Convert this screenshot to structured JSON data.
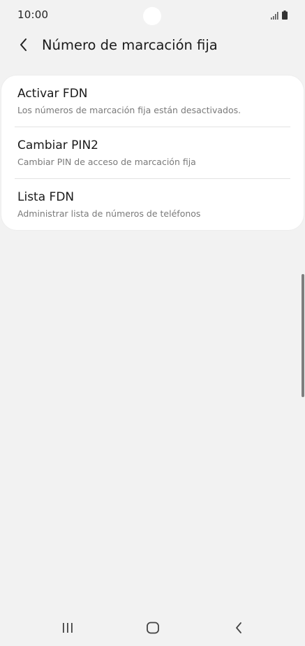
{
  "status_bar": {
    "time": "10:00",
    "icons": [
      "signal-icon",
      "battery-icon"
    ]
  },
  "header": {
    "back_icon": "chevron-left-icon",
    "title": "Número de marcación fija"
  },
  "settings": {
    "items": [
      {
        "title": "Activar FDN",
        "subtitle": "Los números de marcación fija están desactivados."
      },
      {
        "title": "Cambiar PIN2",
        "subtitle": "Cambiar PIN de acceso de marcación fija"
      },
      {
        "title": "Lista FDN",
        "subtitle": "Administrar lista de números de teléfonos"
      }
    ]
  },
  "nav_bar": {
    "icons": [
      "recent-apps-icon",
      "home-icon",
      "back-icon"
    ]
  },
  "colors": {
    "background": "#f2f2f2",
    "card": "#ffffff",
    "primary_text": "#1a1a1a",
    "secondary_text": "#7a7a7a",
    "divider": "#e2e2e2"
  }
}
